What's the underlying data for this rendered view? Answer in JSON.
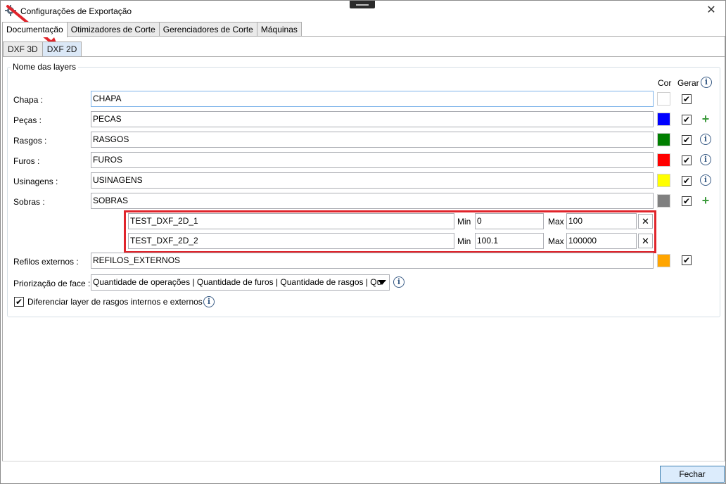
{
  "window": {
    "title": "Configurações de Exportação",
    "close_glyph": "✕"
  },
  "tabs": [
    {
      "label": "Documentação"
    },
    {
      "label": "Otimizadores de Corte"
    },
    {
      "label": "Gerenciadores de Corte"
    },
    {
      "label": "Máquinas"
    }
  ],
  "subtabs": [
    {
      "label": "DXF 3D"
    },
    {
      "label": "DXF 2D"
    }
  ],
  "group": {
    "title": "Nome das layers",
    "col_color": "Cor",
    "col_generate": "Gerar"
  },
  "layers": [
    {
      "label": "Chapa :",
      "value": "CHAPA",
      "color": "#ffffff",
      "checked": "✔"
    },
    {
      "label": "Peças :",
      "value": "PECAS",
      "color": "#0000ff",
      "checked": "✔"
    },
    {
      "label": "Rasgos :",
      "value": "RASGOS",
      "color": "#007f00",
      "checked": "✔"
    },
    {
      "label": "Furos :",
      "value": "FUROS",
      "color": "#ff0000",
      "checked": "✔"
    },
    {
      "label": "Usinagens :",
      "value": "USINAGENS",
      "color": "#ffff00",
      "checked": "✔"
    },
    {
      "label": "Sobras :",
      "value": "SOBRAS",
      "color": "#808080",
      "checked": "✔"
    }
  ],
  "sobras_ranges": [
    {
      "name": "TEST_DXF_2D_1",
      "min_label": "Min",
      "min": "0",
      "max_label": "Max",
      "max": "100",
      "remove": "✕"
    },
    {
      "name": "TEST_DXF_2D_2",
      "min_label": "Min",
      "min": "100.1",
      "max_label": "Max",
      "max": "100000",
      "remove": "✕"
    }
  ],
  "refilos": {
    "label": "Refilos externos :",
    "value": "REFILOS_EXTERNOS",
    "color": "#ffa500",
    "checked": "✔"
  },
  "priority": {
    "label": "Priorização de face :",
    "value": "Quantidade de operações | Quantidade de furos | Quantidade de rasgos | Qu"
  },
  "differentiate": {
    "checked": "✔",
    "label": "Diferenciar layer de rasgos internos e externos"
  },
  "footer": {
    "close_label": "Fechar"
  },
  "icons": {
    "info": "i",
    "plus": "+"
  }
}
